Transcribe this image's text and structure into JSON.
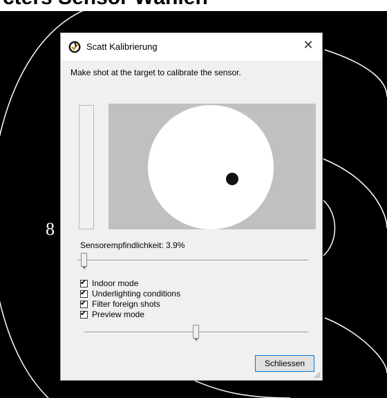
{
  "background": {
    "heading": "cters Sensor Wählen",
    "ring_number": "8"
  },
  "dialog": {
    "title": "Scatt Kalibrierung",
    "close_glyph": "✕",
    "instruction": "Make shot at the target to calibrate the sensor.",
    "sensitivity_label": "Sensorempfindlichkeit: 3.9%",
    "sensitivity_slider_fraction": 0.03,
    "preview_slider_fraction": 0.5,
    "checkboxes": [
      {
        "label": "Indoor mode",
        "checked": true
      },
      {
        "label": "Underlighting conditions",
        "checked": true
      },
      {
        "label": "Filter foreign shots",
        "checked": true
      },
      {
        "label": "Preview mode",
        "checked": true
      }
    ],
    "close_button": "Schliessen"
  },
  "colors": {
    "background": "#000000",
    "dialog_bg": "#f0f0f0",
    "preview_bg": "#c0c0c0",
    "button_border": "#0078d7"
  },
  "icons": {
    "app": "scatt-logo-icon",
    "close": "close-icon",
    "grip": "resize-grip-icon"
  }
}
